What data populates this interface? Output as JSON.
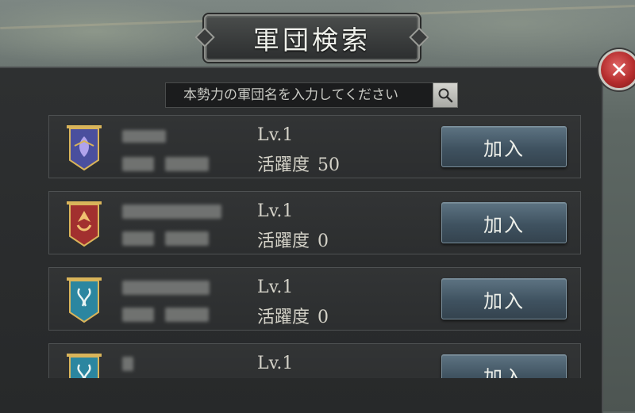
{
  "window": {
    "title": "軍団検索"
  },
  "search": {
    "placeholder": "本勢力の軍団名を入力してください"
  },
  "join_label": "加入",
  "activity_label": "活躍度",
  "legions": [
    {
      "level": "Lv.1",
      "activity": "50",
      "emblem_color": "#4a4f9e",
      "trim_color": "#d9b45a"
    },
    {
      "level": "Lv.1",
      "activity": "0",
      "emblem_color": "#a2302f",
      "trim_color": "#d9b45a"
    },
    {
      "level": "Lv.1",
      "activity": "0",
      "emblem_color": "#2b86a0",
      "trim_color": "#d9b45a"
    },
    {
      "level": "Lv.1",
      "activity": "",
      "emblem_color": "#2b86a0",
      "trim_color": "#d9b45a"
    }
  ],
  "colors": {
    "close": "#b52d2d",
    "button": "#3f5260"
  },
  "icons": {
    "close": "close-icon",
    "search": "search-icon",
    "emblem": "legion-emblem-icon"
  }
}
